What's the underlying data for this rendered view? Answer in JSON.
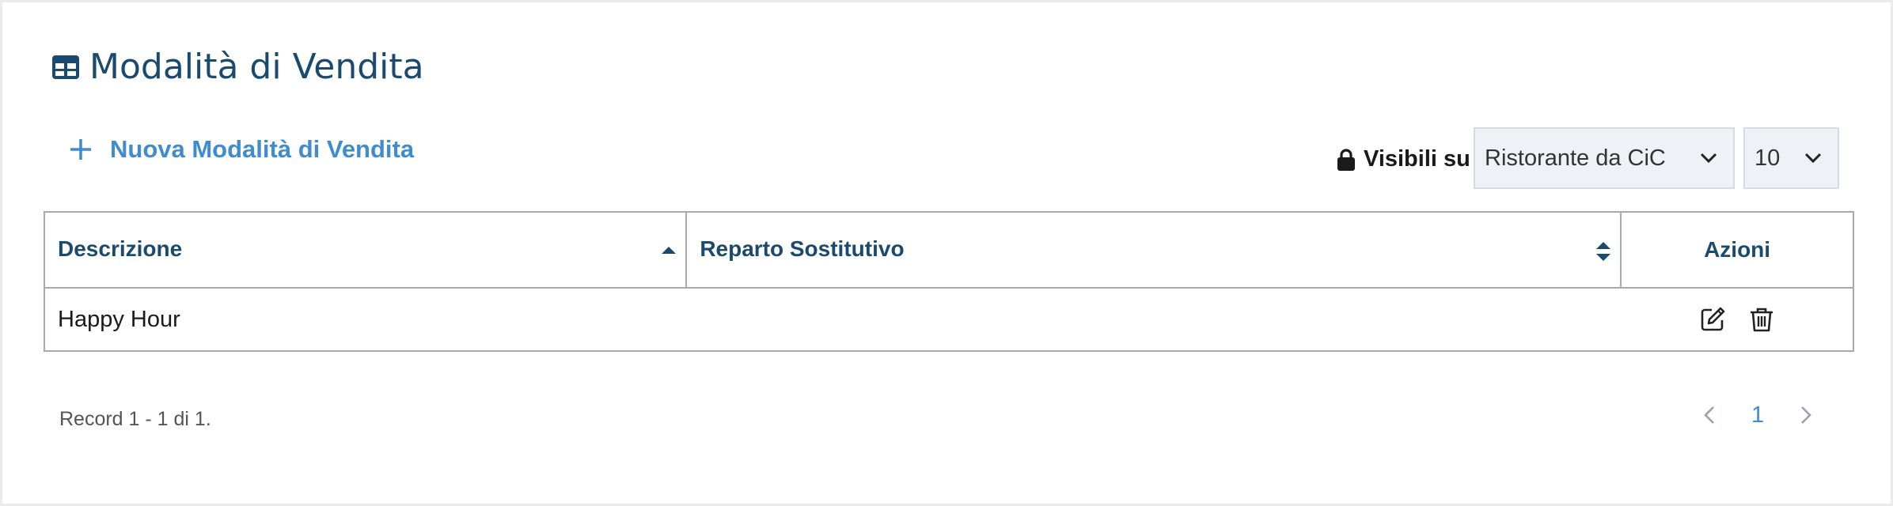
{
  "header": {
    "title": "Modalità di Vendita",
    "icon": "table-icon"
  },
  "toolbar": {
    "new_label": "Nuova Modalità di Vendita",
    "visibility_label": "Visibili su",
    "store_select": "Ristorante da CiC",
    "page_size_select": "10"
  },
  "table": {
    "columns": [
      "Descrizione",
      "Reparto Sostitutivo",
      "Azioni"
    ],
    "sort": {
      "column": "Descrizione",
      "direction": "ascending"
    },
    "rows": [
      {
        "descrizione": "Happy Hour",
        "reparto_sostitutivo": ""
      }
    ]
  },
  "footer": {
    "record_info": "Record 1 - 1 di 1.",
    "current_page": "1"
  },
  "colors": {
    "title": "#1a4a6e",
    "accent": "#3f8ccf",
    "select_bg": "#eef1f6",
    "border": "#a9a9a9"
  }
}
